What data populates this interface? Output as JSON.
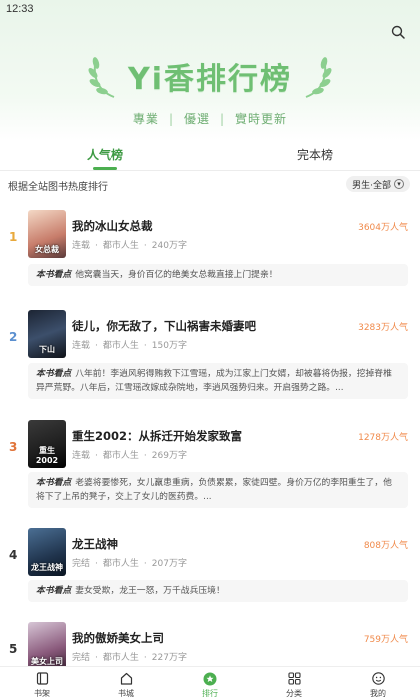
{
  "status_bar": {
    "time": "12:33"
  },
  "hero": {
    "title": "Yi香排行榜",
    "subtitle_items": [
      "專業",
      "優選",
      "實時更新"
    ]
  },
  "tabs": [
    {
      "label": "人气榜",
      "active": true
    },
    {
      "label": "完本榜",
      "active": false
    }
  ],
  "filter": {
    "description": "根据全站图书热度排行",
    "gender_label": "男生·全部"
  },
  "books": [
    {
      "rank": "1",
      "rank_color": "#e8a93c",
      "title": "我的冰山女总裁",
      "status": "连载",
      "category": "都市人生",
      "words": "240万字",
      "popularity": "3604万人气",
      "cover_text": "女总裁",
      "blurb_label": "本书看点",
      "blurb": "他窝囊当天，身价百亿的绝美女总裁直接上门提亲！"
    },
    {
      "rank": "2",
      "rank_color": "#5b8fcf",
      "title": "徒儿，你无敌了，下山祸害未婚妻吧",
      "status": "连载",
      "category": "都市人生",
      "words": "150万字",
      "popularity": "3283万人气",
      "cover_text": "下山",
      "blurb_label": "本书看点",
      "blurb": "八年前！李逍风躬得贿救下江雪瑶，成为江家上门女婿，却被暮将伪报，挖掉脊椎异严荒野。八年后，江雪瑶改嫁成杂院地，李逍风强势归来。开启强势之路。..."
    },
    {
      "rank": "3",
      "rank_color": "#e0743a",
      "title": "重生2002：从拆迁开始发家致富",
      "status": "连载",
      "category": "都市人生",
      "words": "269万字",
      "popularity": "1278万人气",
      "cover_text": "重生2002",
      "blurb_label": "本书看点",
      "blurb": "老婆将要惨死，女儿羸患重病，负债累累，家徒四壁。身价万亿的李阳重生了，他将下了上吊的凳子，交上了女儿的医药费。..."
    },
    {
      "rank": "4",
      "rank_color": "#333333",
      "title": "龙王战神",
      "status": "完结",
      "category": "都市人生",
      "words": "207万字",
      "popularity": "808万人气",
      "cover_text": "龙王战神",
      "blurb_label": "本书看点",
      "blurb": "妻女受欺，龙王一怒，万千战兵压境！"
    },
    {
      "rank": "5",
      "rank_color": "#333333",
      "title": "我的傲娇美女上司",
      "status": "完结",
      "category": "都市人生",
      "words": "227万字",
      "popularity": "759万人气",
      "cover_text": "美女上司",
      "blurb_label": "",
      "blurb": ""
    }
  ],
  "bottom_nav": [
    {
      "label": "书架",
      "icon": "bookshelf-icon",
      "active": false
    },
    {
      "label": "书城",
      "icon": "home-icon",
      "active": false
    },
    {
      "label": "排行",
      "icon": "ranking-icon",
      "active": true
    },
    {
      "label": "分类",
      "icon": "category-grid-icon",
      "active": false
    },
    {
      "label": "我的",
      "icon": "profile-icon",
      "active": false
    }
  ],
  "colors": {
    "accent": "#4caf50",
    "popularity": "#f08a4b"
  }
}
